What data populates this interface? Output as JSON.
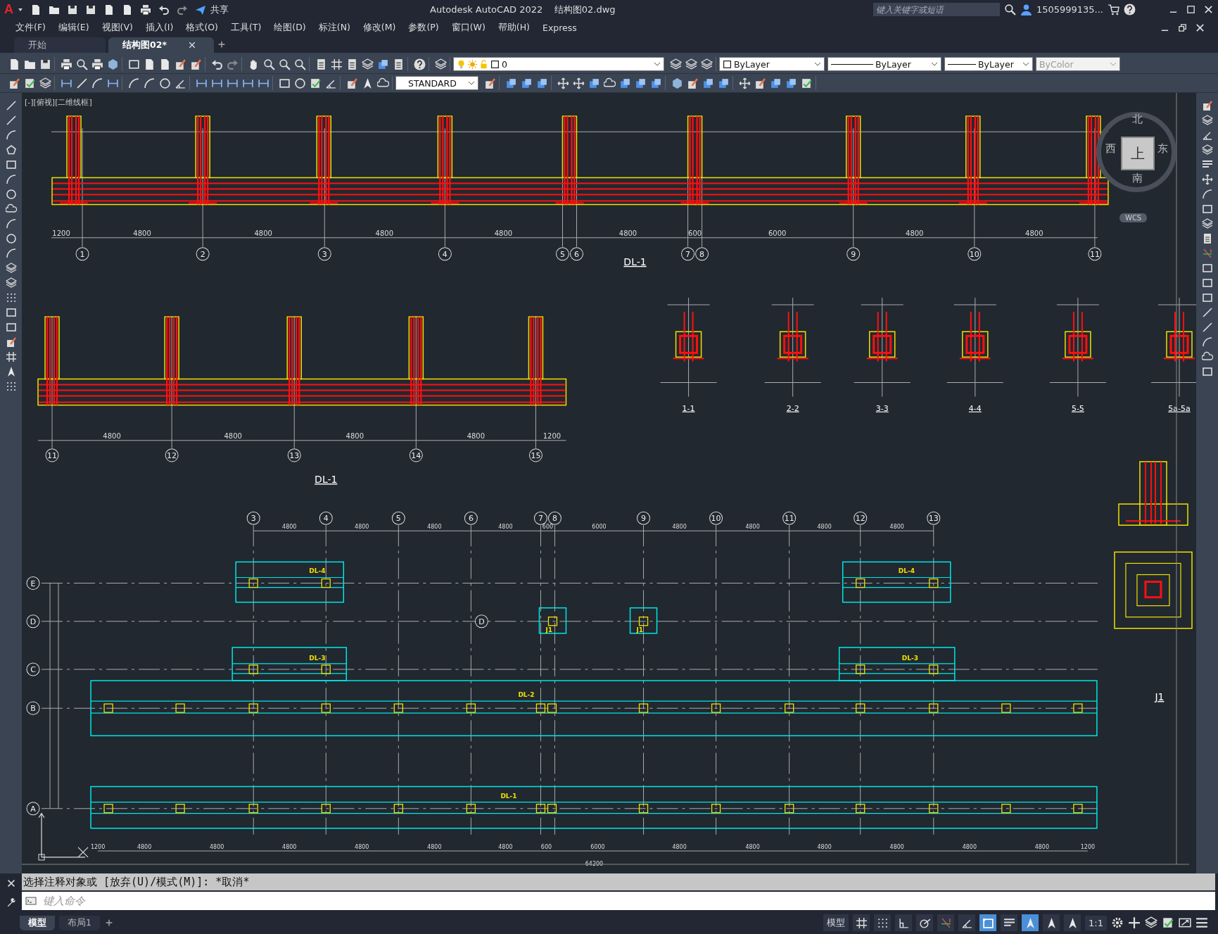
{
  "title_bar": {
    "logo": "A",
    "share": "共享",
    "app_title": "Autodesk AutoCAD 2022",
    "file_name": "结构图02.dwg",
    "search": {
      "placeholder": "键入关键字或短语"
    },
    "user": "1505999135..."
  },
  "menu": [
    "文件(F)",
    "编辑(E)",
    "视图(V)",
    "插入(I)",
    "格式(O)",
    "工具(T)",
    "绘图(D)",
    "标注(N)",
    "修改(M)",
    "参数(P)",
    "窗口(W)",
    "帮助(H)",
    "Express"
  ],
  "file_tabs": [
    {
      "label": "开始",
      "selected": false
    },
    {
      "label": "结构图02*",
      "selected": true
    }
  ],
  "properties": {
    "layer": "0",
    "text_style": "STANDARD",
    "color_control": "ByLayer",
    "linetype": "ByLayer",
    "lineweight": "ByLayer",
    "plot_style": "ByColor"
  },
  "viewport_label": "[-][俯视][二维线框]",
  "view_cube": {
    "north": "北",
    "east": "东",
    "south": "南",
    "west": "西",
    "face": "上",
    "ucs": "WCS"
  },
  "elevation_1": {
    "axes": [
      "1",
      "2",
      "3",
      "4",
      "5",
      "6",
      "7",
      "8",
      "9",
      "10",
      "11"
    ],
    "spans": [
      "1200",
      "4800",
      "4800",
      "4800",
      "4800",
      "4800",
      "600",
      "6000",
      "4800",
      "4800"
    ],
    "title": "DL-1"
  },
  "elevation_2": {
    "axes": [
      "11",
      "12",
      "13",
      "14",
      "15"
    ],
    "spans": [
      "4800",
      "4800",
      "4800",
      "4800",
      "1200"
    ],
    "title": "DL-1"
  },
  "sections": [
    "1-1",
    "2-2",
    "3-3",
    "4-4",
    "5-5",
    "5a-5a"
  ],
  "plan": {
    "column_axes": [
      "3",
      "4",
      "5",
      "6",
      "7",
      "8",
      "9",
      "10",
      "11",
      "12",
      "13"
    ],
    "row_axes": [
      "E",
      "D",
      "C",
      "B",
      "A"
    ],
    "extra_row_axis": "D",
    "top_spans": [
      "4800",
      "4800",
      "4800",
      "4800",
      "600",
      "6000",
      "4800",
      "4800",
      "4800",
      "4800"
    ],
    "bottom_spans": [
      "1200",
      "4800",
      "4800",
      "4800",
      "4800",
      "4800",
      "4800",
      "600",
      "6000",
      "4800",
      "4800",
      "4800",
      "4800",
      "4800",
      "4800",
      "1200"
    ],
    "total": "64200",
    "beams": [
      "DL-4",
      "DL-4",
      "DL-3",
      "DL-3",
      "DL-2",
      "DL-1"
    ],
    "footings": [
      "J1",
      "J1"
    ]
  },
  "detail_title": "J1",
  "command_history": "选择注释对象或 [放弃(U)/模式(M)]: *取消*",
  "command_input": {
    "placeholder": "键入命令"
  },
  "layout_tabs": [
    {
      "label": "模型",
      "selected": true
    },
    {
      "label": "布局1",
      "selected": false
    }
  ],
  "status_bar": {
    "space": "模型",
    "scale": "1:1",
    "toggles": [
      {
        "kind": "grid",
        "on": false
      },
      {
        "kind": "dots",
        "on": false
      },
      {
        "kind": "ortho",
        "on": false
      },
      {
        "kind": "polar",
        "on": false
      },
      {
        "kind": "osnap",
        "on": false
      },
      {
        "kind": "angle",
        "on": false
      },
      {
        "kind": "select",
        "on": true
      },
      {
        "kind": "lineweight",
        "on": false
      },
      {
        "kind": "annotate",
        "on": true
      },
      {
        "kind": "annotate",
        "on": false
      },
      {
        "kind": "annotate",
        "on": false
      }
    ]
  }
}
